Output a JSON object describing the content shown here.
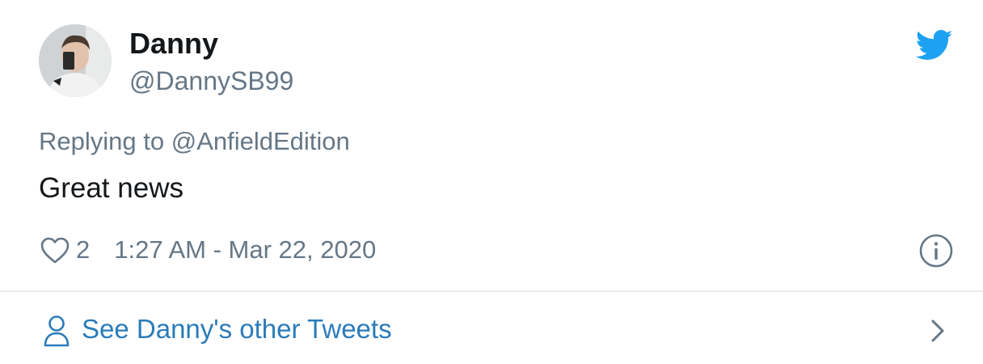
{
  "user": {
    "display_name": "Danny",
    "handle": "@DannySB99",
    "avatar_icon": "profile-photo"
  },
  "reply": {
    "prefix": "Replying to ",
    "mention": "@AnfieldEdition"
  },
  "tweet": {
    "text": "Great news",
    "like_count": "2",
    "timestamp": "1:27 AM - Mar 22, 2020"
  },
  "icons": {
    "brand": "twitter-bird-icon",
    "like": "heart-icon",
    "info": "info-icon",
    "profile": "person-icon",
    "next": "chevron-right-icon"
  },
  "footer": {
    "label": "See Danny's other Tweets"
  },
  "colors": {
    "brand_blue": "#1da1f2",
    "link_blue": "#2b7bb9",
    "secondary_text": "#657786",
    "primary_text": "#14171a",
    "divider": "#e6ecf0"
  }
}
